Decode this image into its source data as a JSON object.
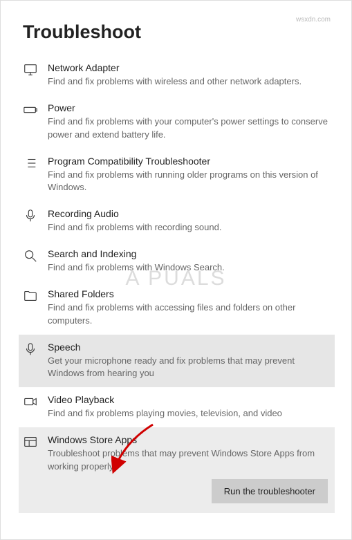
{
  "page_title": "Troubleshoot",
  "items": [
    {
      "title": "Network Adapter",
      "desc": "Find and fix problems with wireless and other network adapters."
    },
    {
      "title": "Power",
      "desc": "Find and fix problems with your computer's power settings to conserve power and extend battery life."
    },
    {
      "title": "Program Compatibility Troubleshooter",
      "desc": "Find and fix problems with running older programs on this version of Windows."
    },
    {
      "title": "Recording Audio",
      "desc": "Find and fix problems with recording sound."
    },
    {
      "title": "Search and Indexing",
      "desc": "Find and fix problems with Windows Search."
    },
    {
      "title": "Shared Folders",
      "desc": "Find and fix problems with accessing files and folders on other computers."
    },
    {
      "title": "Speech",
      "desc": "Get your microphone ready and fix problems that may prevent Windows from hearing you"
    },
    {
      "title": "Video Playback",
      "desc": "Find and fix problems playing movies, television, and video"
    },
    {
      "title": "Windows Store Apps",
      "desc": "Troubleshoot problems that may prevent Windows Store Apps from working properly"
    }
  ],
  "run_button": "Run the troubleshooter",
  "watermark": "A  PUALS",
  "footer_mark": "wsxdn.com"
}
